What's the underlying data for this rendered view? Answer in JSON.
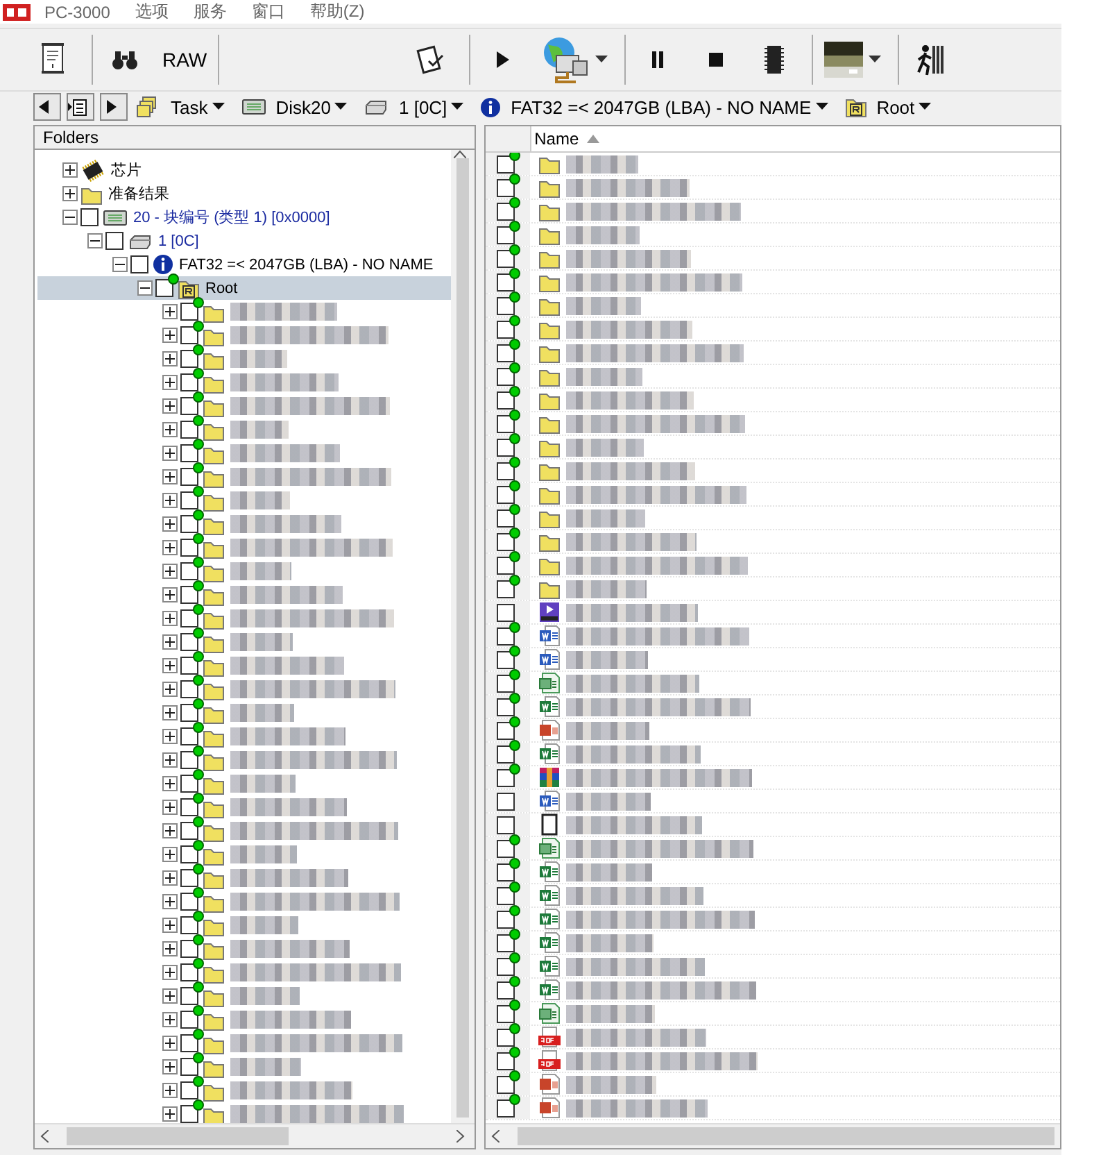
{
  "app": {
    "logo": "PC-3000",
    "menu": [
      "选项",
      "服务",
      "窗口",
      "帮助(Z)"
    ]
  },
  "toolbar": [
    {
      "kind": "script"
    },
    {
      "kind": "sep"
    },
    {
      "kind": "binoculars"
    },
    {
      "kind": "text",
      "label": "RAW"
    },
    {
      "kind": "sep"
    },
    {
      "kind": "space"
    },
    {
      "kind": "clipboard"
    },
    {
      "kind": "sep"
    },
    {
      "kind": "play"
    },
    {
      "kind": "network",
      "dropdown": true
    },
    {
      "kind": "sep"
    },
    {
      "kind": "pause"
    },
    {
      "kind": "stop"
    },
    {
      "kind": "chip"
    },
    {
      "kind": "sep"
    },
    {
      "kind": "image",
      "dropdown": true
    },
    {
      "kind": "sep"
    },
    {
      "kind": "exit"
    }
  ],
  "breadcrumb": [
    {
      "kind": "task",
      "label": "Task"
    },
    {
      "kind": "disk",
      "label": "Disk20"
    },
    {
      "kind": "drive",
      "label": "1 [0C]"
    },
    {
      "kind": "info",
      "label": "FAT32 =< 2047GB (LBA) - NO NAME"
    },
    {
      "kind": "root",
      "label": "Root"
    }
  ],
  "folders_panel": {
    "title": "Folders",
    "tree": [
      {
        "kind": "chip",
        "label": "芯片",
        "expanded": false,
        "selected": false
      },
      {
        "kind": "folder",
        "label": "准备结果",
        "expanded": false,
        "selected": false
      },
      {
        "kind": "disk",
        "label": "20 - 块编号 (类型 1) [0x0000]",
        "expanded": true,
        "checked": false,
        "selected": false,
        "children": [
          {
            "kind": "drive",
            "label": "1 [0C]",
            "expanded": true,
            "checked": false,
            "selected": false,
            "children": [
              {
                "kind": "info",
                "label": "FAT32 =< 2047GB (LBA) - NO NAME",
                "expanded": true,
                "checked": false,
                "selected": false,
                "children": [
                  {
                    "kind": "root",
                    "label": "Root",
                    "expanded": true,
                    "checked": false,
                    "marked": true,
                    "selected": true,
                    "children": [
                      {
                        "kind": "folder",
                        "expanded": false,
                        "checked": false,
                        "marked": true,
                        "selected": false
                      },
                      {
                        "kind": "folder",
                        "expanded": false,
                        "checked": false,
                        "marked": true,
                        "selected": false
                      },
                      {
                        "kind": "folder",
                        "expanded": false,
                        "checked": false,
                        "marked": true,
                        "selected": false
                      },
                      {
                        "kind": "folder",
                        "expanded": false,
                        "checked": false,
                        "marked": true,
                        "selected": false
                      },
                      {
                        "kind": "folder",
                        "expanded": false,
                        "checked": false,
                        "marked": true,
                        "selected": false
                      },
                      {
                        "kind": "folder",
                        "expanded": false,
                        "checked": false,
                        "marked": true,
                        "selected": false
                      },
                      {
                        "kind": "folder",
                        "expanded": false,
                        "checked": false,
                        "marked": true,
                        "selected": false
                      },
                      {
                        "kind": "folder",
                        "expanded": false,
                        "checked": false,
                        "marked": true,
                        "selected": false
                      },
                      {
                        "kind": "folder",
                        "expanded": false,
                        "checked": false,
                        "marked": true,
                        "selected": false
                      },
                      {
                        "kind": "folder",
                        "expanded": false,
                        "checked": false,
                        "marked": true,
                        "selected": false
                      },
                      {
                        "kind": "folder",
                        "expanded": false,
                        "checked": false,
                        "marked": true,
                        "selected": false
                      },
                      {
                        "kind": "folder",
                        "expanded": false,
                        "checked": false,
                        "marked": true,
                        "selected": false
                      },
                      {
                        "kind": "folder",
                        "expanded": false,
                        "checked": false,
                        "marked": true,
                        "selected": false
                      },
                      {
                        "kind": "folder",
                        "expanded": false,
                        "checked": false,
                        "marked": true,
                        "selected": false
                      },
                      {
                        "kind": "folder",
                        "expanded": false,
                        "checked": false,
                        "marked": true,
                        "selected": false
                      },
                      {
                        "kind": "folder",
                        "expanded": false,
                        "checked": false,
                        "marked": true,
                        "selected": false
                      },
                      {
                        "kind": "folder",
                        "expanded": false,
                        "checked": false,
                        "marked": true,
                        "selected": false
                      },
                      {
                        "kind": "folder",
                        "expanded": false,
                        "checked": false,
                        "marked": true,
                        "selected": false
                      },
                      {
                        "kind": "folder",
                        "expanded": false,
                        "checked": false,
                        "marked": true,
                        "selected": false
                      },
                      {
                        "kind": "folder",
                        "expanded": false,
                        "checked": false,
                        "marked": true,
                        "selected": false
                      },
                      {
                        "kind": "folder",
                        "expanded": false,
                        "checked": false,
                        "marked": true,
                        "selected": false
                      },
                      {
                        "kind": "folder",
                        "expanded": false,
                        "checked": false,
                        "marked": true,
                        "selected": false
                      },
                      {
                        "kind": "folder",
                        "expanded": false,
                        "checked": false,
                        "marked": true,
                        "selected": false
                      },
                      {
                        "kind": "folder",
                        "expanded": false,
                        "checked": false,
                        "marked": true,
                        "selected": false
                      },
                      {
                        "kind": "folder",
                        "expanded": false,
                        "checked": false,
                        "marked": true,
                        "selected": false
                      },
                      {
                        "kind": "folder",
                        "expanded": false,
                        "checked": false,
                        "marked": true,
                        "selected": false
                      },
                      {
                        "kind": "folder",
                        "expanded": false,
                        "checked": false,
                        "marked": true,
                        "selected": false
                      },
                      {
                        "kind": "folder",
                        "expanded": false,
                        "checked": false,
                        "marked": true,
                        "selected": false
                      },
                      {
                        "kind": "folder",
                        "expanded": false,
                        "checked": false,
                        "marked": true,
                        "selected": false
                      },
                      {
                        "kind": "folder",
                        "expanded": false,
                        "checked": false,
                        "marked": true,
                        "selected": false
                      },
                      {
                        "kind": "folder",
                        "expanded": false,
                        "checked": false,
                        "marked": true,
                        "selected": false
                      },
                      {
                        "kind": "folder",
                        "expanded": false,
                        "checked": false,
                        "marked": true,
                        "selected": false
                      },
                      {
                        "kind": "folder",
                        "expanded": false,
                        "checked": false,
                        "marked": true,
                        "selected": false
                      },
                      {
                        "kind": "folder",
                        "expanded": false,
                        "checked": false,
                        "marked": true,
                        "selected": false
                      },
                      {
                        "kind": "folder",
                        "expanded": false,
                        "checked": false,
                        "marked": true,
                        "selected": false
                      }
                    ]
                  }
                ]
              }
            ]
          }
        ]
      }
    ]
  },
  "file_list": {
    "columns": [
      {
        "label": "Name",
        "sorted": true
      }
    ],
    "rows": [
      {
        "kind": "folder",
        "checked": false,
        "marked": true
      },
      {
        "kind": "folder",
        "checked": false,
        "marked": true
      },
      {
        "kind": "folder",
        "checked": false,
        "marked": true
      },
      {
        "kind": "folder",
        "checked": false,
        "marked": true
      },
      {
        "kind": "folder",
        "checked": false,
        "marked": true
      },
      {
        "kind": "folder",
        "checked": false,
        "marked": true
      },
      {
        "kind": "folder",
        "checked": false,
        "marked": true
      },
      {
        "kind": "folder",
        "checked": false,
        "marked": true
      },
      {
        "kind": "folder",
        "checked": false,
        "marked": true
      },
      {
        "kind": "folder",
        "checked": false,
        "marked": true
      },
      {
        "kind": "folder",
        "checked": false,
        "marked": true
      },
      {
        "kind": "folder",
        "checked": false,
        "marked": true
      },
      {
        "kind": "folder",
        "checked": false,
        "marked": true
      },
      {
        "kind": "folder",
        "checked": false,
        "marked": true
      },
      {
        "kind": "folder",
        "checked": false,
        "marked": true
      },
      {
        "kind": "folder",
        "checked": false,
        "marked": true
      },
      {
        "kind": "folder",
        "checked": false,
        "marked": true
      },
      {
        "kind": "folder",
        "checked": false,
        "marked": true
      },
      {
        "kind": "folder",
        "checked": false,
        "marked": true
      },
      {
        "kind": "video",
        "checked": false,
        "marked": false
      },
      {
        "kind": "word",
        "checked": false,
        "marked": true
      },
      {
        "kind": "word",
        "checked": false,
        "marked": true
      },
      {
        "kind": "csv",
        "checked": false,
        "marked": true
      },
      {
        "kind": "excel",
        "checked": false,
        "marked": true
      },
      {
        "kind": "ppt",
        "checked": false,
        "marked": true
      },
      {
        "kind": "excel",
        "checked": false,
        "marked": true
      },
      {
        "kind": "archive",
        "checked": false,
        "marked": true
      },
      {
        "kind": "word",
        "checked": false,
        "marked": false
      },
      {
        "kind": "blank",
        "checked": false,
        "marked": false
      },
      {
        "kind": "csv",
        "checked": false,
        "marked": true
      },
      {
        "kind": "excel",
        "checked": false,
        "marked": true
      },
      {
        "kind": "excel",
        "checked": false,
        "marked": true
      },
      {
        "kind": "excel",
        "checked": false,
        "marked": true
      },
      {
        "kind": "excel",
        "checked": false,
        "marked": true
      },
      {
        "kind": "excel",
        "checked": false,
        "marked": true
      },
      {
        "kind": "excel",
        "checked": false,
        "marked": true
      },
      {
        "kind": "csv",
        "checked": false,
        "marked": true
      },
      {
        "kind": "pdf",
        "checked": false,
        "marked": true
      },
      {
        "kind": "pdf",
        "checked": false,
        "marked": true
      },
      {
        "kind": "ppt",
        "checked": false,
        "marked": true
      },
      {
        "kind": "ppt",
        "checked": false,
        "marked": true
      }
    ]
  }
}
